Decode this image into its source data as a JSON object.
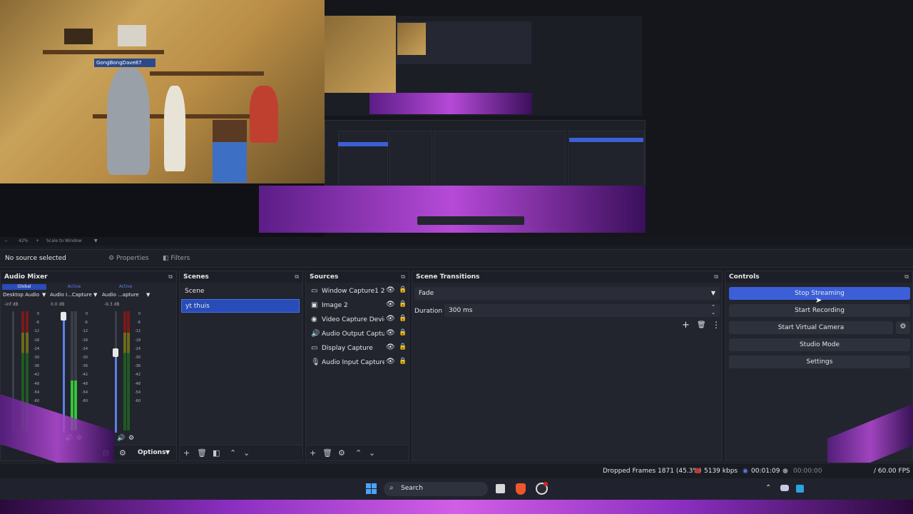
{
  "preview": {
    "overlay_name": "GongBongDave87",
    "zoom": "42%",
    "scale_mode": "Scale to Window"
  },
  "source_toolbar": {
    "no_source": "No source selected",
    "properties": "Properties",
    "filters": "Filters"
  },
  "audio_mixer": {
    "title": "Audio Mixer",
    "channels": [
      {
        "tag": "Global",
        "name": "Desktop Audio",
        "db": "-inf dB"
      },
      {
        "tag": "Active",
        "name": "Audio I...Capture",
        "db": "0.0 dB"
      },
      {
        "tag": "Active",
        "name": "Audio ...apture",
        "db": "-9.3 dB"
      }
    ],
    "scale": [
      "0",
      "-6",
      "-12",
      "-18",
      "-24",
      "-30",
      "-36",
      "-42",
      "-48",
      "-54",
      "-60"
    ],
    "options_label": "Options"
  },
  "scenes": {
    "title": "Scenes",
    "items": [
      "Scene",
      "yt thuis"
    ],
    "selected": "yt thuis"
  },
  "sources": {
    "title": "Sources",
    "items": [
      {
        "name": "Window Capture1 2",
        "icon": "window-icon"
      },
      {
        "name": "Image 2",
        "icon": "image-icon"
      },
      {
        "name": "Video Capture Device",
        "icon": "camera-icon"
      },
      {
        "name": "Audio Output Captur",
        "icon": "speaker-icon"
      },
      {
        "name": "Display Capture",
        "icon": "monitor-icon"
      },
      {
        "name": "Audio Input Capture",
        "icon": "microphone-icon"
      }
    ]
  },
  "transitions": {
    "title": "Scene Transitions",
    "selected": "Fade",
    "duration_label": "Duration",
    "duration_value": "300 ms"
  },
  "controls": {
    "title": "Controls",
    "buttons": [
      "Stop Streaming",
      "Start Recording",
      "Start Virtual Camera",
      "Studio Mode",
      "Settings"
    ]
  },
  "status": {
    "dropped_frames": "Dropped Frames 1871 (45.3%)",
    "bitrate": "5139 kbps",
    "stream_time": "00:01:09",
    "rec_time": "00:00:00",
    "fps": "/ 60.00 FPS"
  },
  "taskbar": {
    "search_placeholder": "Search"
  },
  "colors": {
    "accent": "#3c5fd8",
    "selection": "#284cb8",
    "background": "#22252e"
  }
}
